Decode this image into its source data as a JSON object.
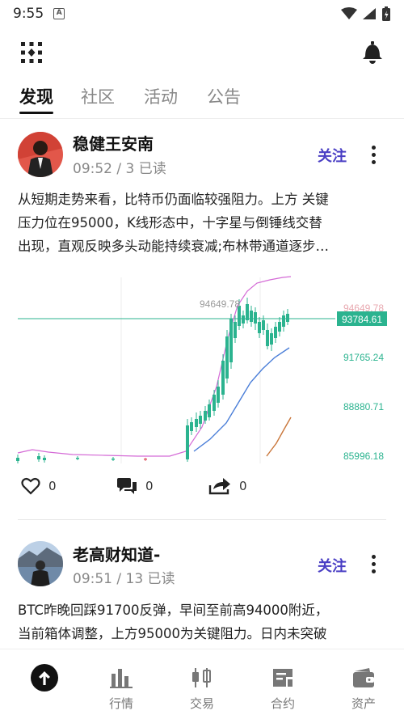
{
  "status_bar": {
    "time": "9:55"
  },
  "tabs": [
    {
      "label": "发现",
      "active": true
    },
    {
      "label": "社区",
      "active": false
    },
    {
      "label": "活动",
      "active": false
    },
    {
      "label": "公告",
      "active": false
    }
  ],
  "posts": [
    {
      "author": "稳健王安南",
      "meta": "09:52 / 3 已读",
      "follow_label": "关注",
      "text_lines": [
        "从短期走势来看，比特币仍面临较强阻力。上方 关键",
        "压力位在95000，K线形态中，十字星与倒锤线交替",
        "出现，直观反映多头动能持续衰减;布林带通道逐步…"
      ],
      "likes": "0",
      "comments": "0",
      "shares": "0"
    },
    {
      "author": "老高财知道-",
      "meta": "09:51 / 13 已读",
      "follow_label": "关注",
      "text_lines": [
        "BTC昨晚回踩91700反弹，早间至前高94000附近，",
        "当前箱体调整，上方95000为关键阻力。日内未突破"
      ]
    }
  ],
  "chart_data": {
    "type": "candlestick",
    "y_ticks": [
      "94649.78",
      "91765.24",
      "88880.71",
      "85996.18"
    ],
    "high_label": "94649.78",
    "current_price": "93784.61",
    "colors": {
      "up": "#e05a6a",
      "down": "#2bb38f",
      "current": "#2bb38f",
      "band": "#d46ad6",
      "ma_blue": "#4a7ed8",
      "ma_orange": "#c9763a"
    }
  },
  "bottom_nav": [
    {
      "label": "",
      "icon": "arrow-up-icon",
      "active": true
    },
    {
      "label": "行情",
      "icon": "bar-chart-icon"
    },
    {
      "label": "交易",
      "icon": "candlestick-icon"
    },
    {
      "label": "合约",
      "icon": "contract-icon"
    },
    {
      "label": "资产",
      "icon": "wallet-icon"
    }
  ]
}
